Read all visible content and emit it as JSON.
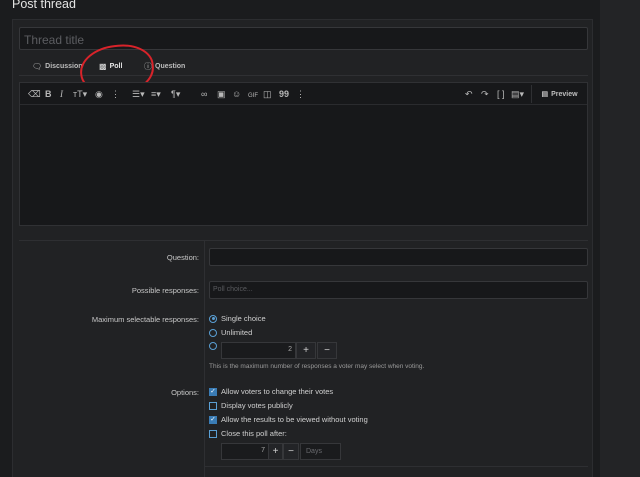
{
  "page": {
    "title": "Post thread"
  },
  "thread": {
    "title_placeholder": "Thread title"
  },
  "tabs": [
    {
      "label": "Discussion",
      "icon": "chat-bubble-icon"
    },
    {
      "label": "Poll",
      "icon": "bar-chart-icon"
    },
    {
      "label": "Question",
      "icon": "question-circle-icon"
    }
  ],
  "editor": {
    "preview_label": "Preview",
    "toolbar_left": [
      "eraser-icon",
      "bold-icon",
      "italic-icon",
      "text-size-icon",
      "palette-icon",
      "more-icon",
      "list-icon",
      "align-icon",
      "paragraph-icon",
      "link-icon",
      "image-icon",
      "emoji-icon",
      "gif-icon",
      "media-icon",
      "quote-icon",
      "more-icon"
    ],
    "toolbar_right": [
      "undo-icon",
      "redo-icon",
      "bbcode-icon",
      "drafts-icon"
    ]
  },
  "poll": {
    "question_label": "Question:",
    "responses_label": "Possible responses:",
    "responses_placeholder": "Poll choice...",
    "max_label": "Maximum selectable responses:",
    "single_choice": "Single choice",
    "unlimited": "Unlimited",
    "max_value": "2",
    "max_hint": "This is the maximum number of responses a voter may select when voting.",
    "options_label": "Options:",
    "opt_change_votes": "Allow voters to change their votes",
    "opt_display_public": "Display votes publicly",
    "opt_view_results": "Allow the results to be viewed without voting",
    "opt_close_poll": "Close this poll after:",
    "close_value": "7",
    "close_unit": "Days",
    "plus": "+",
    "minus": "−"
  },
  "colors": {
    "accent": "#3a7cb5",
    "annotation": "#d8232a",
    "background": "#1b1c1e"
  }
}
